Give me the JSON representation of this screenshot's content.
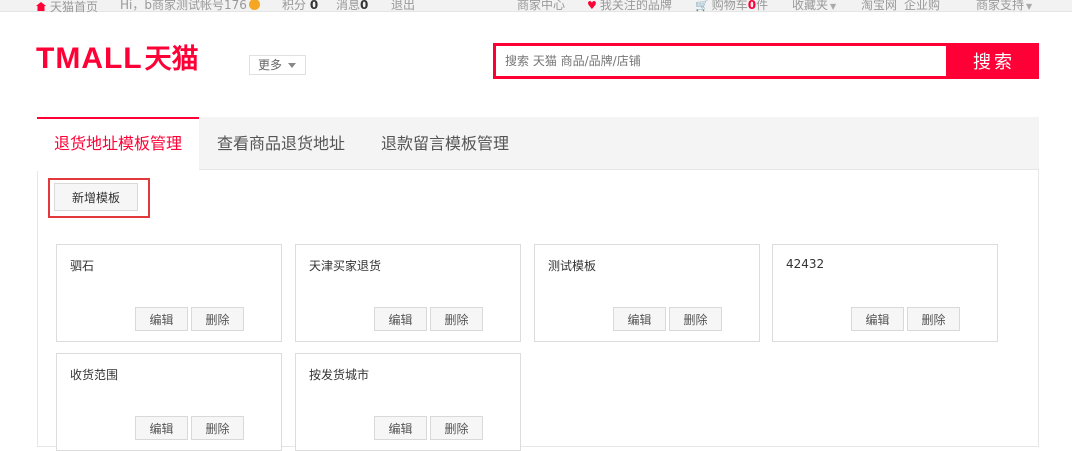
{
  "topbar": {
    "home": "天猫首页",
    "greeting": "Hi，b商家测试帐号176",
    "points_label": "积分",
    "points_value": "0",
    "messages_label": "消息",
    "messages_value": "0",
    "logout": "退出",
    "merchant_center": "商家中心",
    "followed_brands": "我关注的品牌",
    "cart_label": "购物车",
    "cart_count": "0",
    "cart_unit": "件",
    "favorites": "收藏夹",
    "taobao": "淘宝网",
    "enterprise": "企业购",
    "merchant_support": "商家支持"
  },
  "header": {
    "logo_en": "TMALL",
    "logo_cn": "天猫",
    "more": "更多",
    "search_placeholder": "搜索 天猫 商品/品牌/店铺",
    "search_button": "搜索"
  },
  "tabs": [
    {
      "label": "退货地址模板管理",
      "active": true
    },
    {
      "label": "查看商品退货地址",
      "active": false
    },
    {
      "label": "退款留言模板管理",
      "active": false
    }
  ],
  "add_button": "新增模板",
  "card_buttons": {
    "edit": "编辑",
    "delete": "删除"
  },
  "templates": [
    {
      "name": "驷石"
    },
    {
      "name": "天津买家退货"
    },
    {
      "name": "测试模板"
    },
    {
      "name": "42432"
    },
    {
      "name": "收货范围"
    },
    {
      "name": "按发货城市"
    }
  ],
  "colors": {
    "brand": "#ff0036",
    "highlight_border": "#e4393c"
  }
}
